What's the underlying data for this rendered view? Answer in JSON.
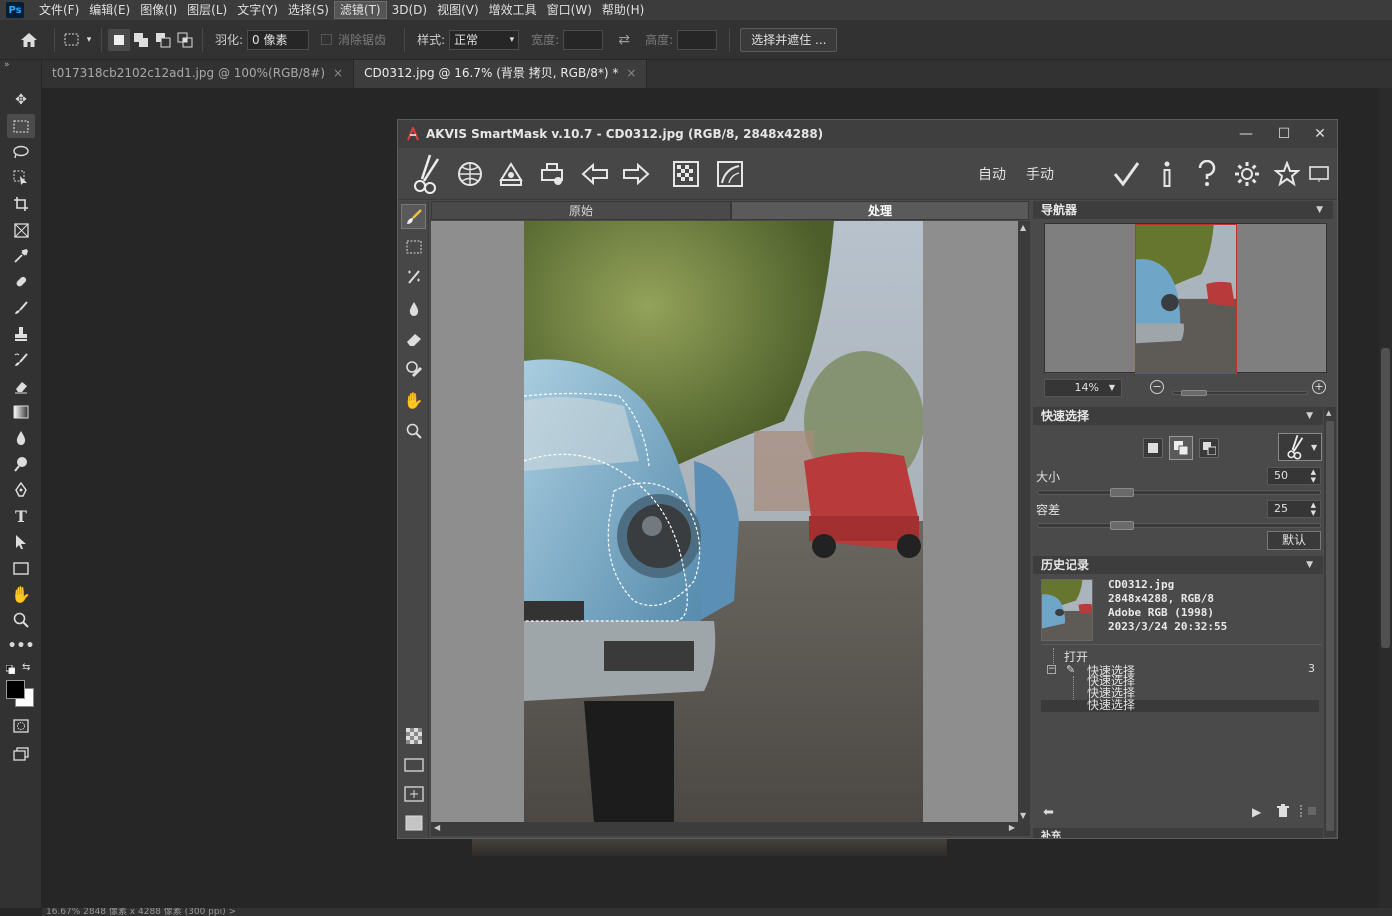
{
  "menubar": {
    "logo": "Ps",
    "items": [
      "文件(F)",
      "编辑(E)",
      "图像(I)",
      "图层(L)",
      "文字(Y)",
      "选择(S)",
      "滤镜(T)",
      "3D(D)",
      "视图(V)",
      "增效工具",
      "窗口(W)",
      "帮助(H)"
    ],
    "active_index": 6
  },
  "options": {
    "feather_label": "羽化:",
    "feather_value": "0 像素",
    "antialias_label": "消除锯齿",
    "style_label": "样式:",
    "style_value": "正常",
    "width_label": "宽度:",
    "height_label": "高度:",
    "select_mask_button": "选择并遮住 ..."
  },
  "tabs": [
    {
      "label": "t017318cb2102c12ad1.jpg @ 100%(RGB/8#)",
      "close": "×",
      "active": false
    },
    {
      "label": "CD0312.jpg @ 16.7% (背景 拷贝, RGB/8*) *",
      "close": "×",
      "active": true
    }
  ],
  "statusbar": {
    "text": "16.67%    2848 像素 x 4288 像素 (300 ppi)    >"
  },
  "plugin": {
    "title": "AKVIS SmartMask v.10.7 - CD0312.jpg (RGB/8, 2848x4288)",
    "mode_auto": "自动",
    "mode_manual": "手动",
    "view_tabs": {
      "original": "原始",
      "processed": "处理",
      "active": "processed"
    },
    "navigator": {
      "title": "导航器",
      "zoom": "14%"
    },
    "quick_select": {
      "title": "快速选择",
      "size_label": "大小",
      "size_value": "50",
      "size_fraction": 0.28,
      "tolerance_label": "容差",
      "tolerance_value": "25",
      "tolerance_fraction": 0.28,
      "default_button": "默认"
    },
    "history": {
      "title": "历史记录",
      "file_name": "CD0312.jpg",
      "file_dims": "2848x4288, RGB/8",
      "file_profile": "Adobe RGB (1998)",
      "file_date": "2023/3/24 20:32:55",
      "open_item": "打开",
      "group_item": "快速选择",
      "group_count": "3",
      "sub_items": [
        "快速选择",
        "快速选择",
        "快速选择"
      ]
    },
    "bottom_panel_title": "补充"
  },
  "colors": {
    "ps_bg": "#262626",
    "panel": "#323232",
    "plugin_bg": "#4a4a4a",
    "nav_frame": "#c03030",
    "close_icon": "#e04040"
  }
}
